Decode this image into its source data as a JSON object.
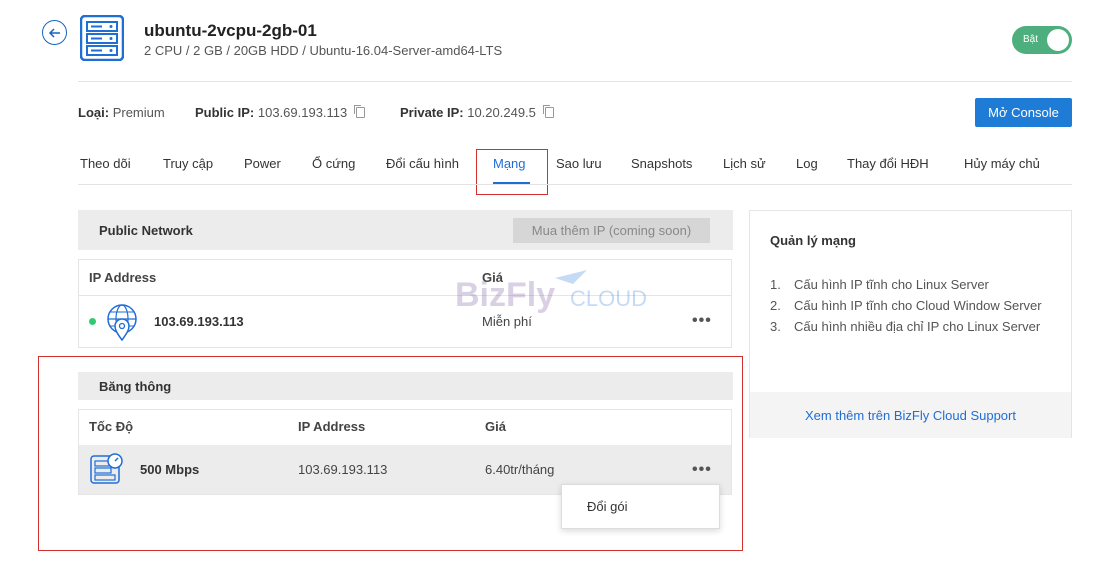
{
  "server": {
    "name": "ubuntu-2vcpu-2gb-01",
    "spec": "2 CPU / 2 GB / 20GB HDD / Ubuntu-16.04-Server-amd64-LTS",
    "power_toggle_label": "Bật"
  },
  "info": {
    "type_label": "Loại:",
    "type_value": "Premium",
    "public_ip_label": "Public IP:",
    "public_ip_value": "103.69.193.113",
    "private_ip_label": "Private IP:",
    "private_ip_value": "10.20.249.5",
    "console_button": "Mở Console"
  },
  "tabs": [
    {
      "label": "Theo dõi"
    },
    {
      "label": "Truy cập"
    },
    {
      "label": "Power"
    },
    {
      "label": "Ổ cứng"
    },
    {
      "label": "Đổi cấu hình"
    },
    {
      "label": "Mạng",
      "active": true
    },
    {
      "label": "Sao lưu"
    },
    {
      "label": "Snapshots"
    },
    {
      "label": "Lịch sử"
    },
    {
      "label": "Log"
    },
    {
      "label": "Thay đổi HĐH"
    },
    {
      "label": "Hủy máy chủ"
    }
  ],
  "public_network": {
    "title": "Public Network",
    "buy_ip_button": "Mua thêm IP (coming soon)",
    "columns": [
      "IP Address",
      "Giá"
    ],
    "rows": [
      {
        "ip": "103.69.193.113",
        "price": "Miễn phí",
        "status_color": "#2ecc71"
      }
    ]
  },
  "bandwidth": {
    "title": "Băng thông",
    "columns": [
      "Tốc Độ",
      "IP Address",
      "Giá"
    ],
    "rows": [
      {
        "speed": "500 Mbps",
        "ip": "103.69.193.113",
        "price": "6.40tr/tháng"
      }
    ],
    "menu": {
      "item": "Đổi gói"
    }
  },
  "sidebar": {
    "title": "Quản lý mạng",
    "items": [
      {
        "n": "1.",
        "text": "Cấu hình IP tĩnh cho Linux Server"
      },
      {
        "n": "2.",
        "text": "Cấu hình IP tĩnh cho Cloud Window Server"
      },
      {
        "n": "3.",
        "text": "Cấu hình nhiều địa chỉ IP cho Linux Server"
      }
    ],
    "footer_link": "Xem thêm trên BizFly Cloud Support"
  },
  "watermark": {
    "text_main": "BizFly",
    "text_sub": "CLOUD"
  },
  "colors": {
    "accent": "#1e6ed6",
    "toggle_on": "#4caf7d",
    "highlight": "#d32f2f",
    "status_online": "#2ecc71"
  }
}
